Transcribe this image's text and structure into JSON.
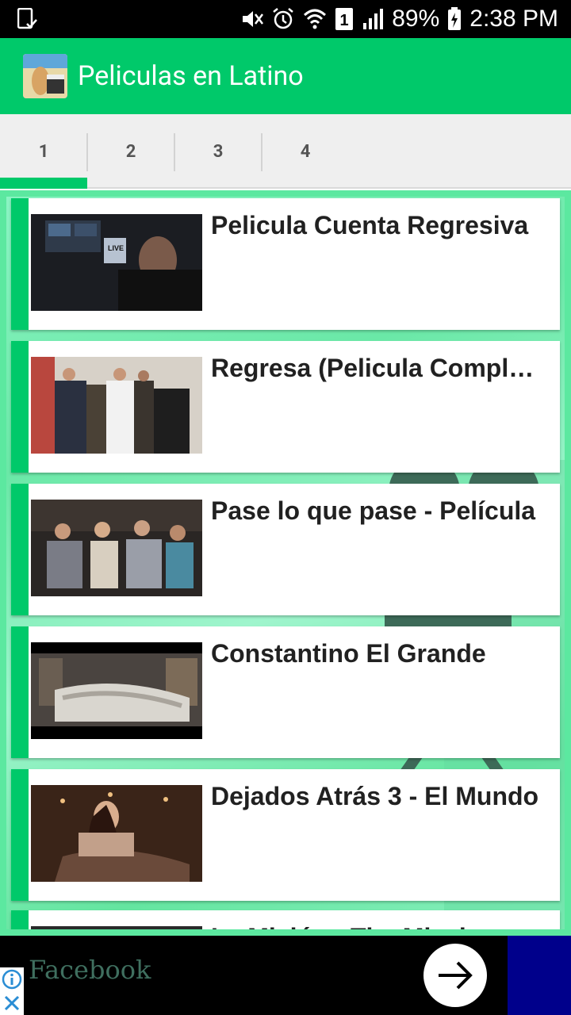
{
  "status_bar": {
    "battery": "89%",
    "time": "2:38 PM",
    "sim_badge": "1",
    "icons": [
      "download-done-icon",
      "mute-icon",
      "alarm-icon",
      "wifi-icon",
      "sim-icon",
      "signal-icon",
      "battery-charging-icon"
    ]
  },
  "app_bar": {
    "title": "Peliculas en Latino",
    "logo_text": "Peliculas en LATINO"
  },
  "tabs": [
    {
      "label": "1",
      "selected": true
    },
    {
      "label": "2",
      "selected": false
    },
    {
      "label": "3",
      "selected": false
    },
    {
      "label": "4",
      "selected": false
    }
  ],
  "videos": [
    {
      "title": "Pelicula Cuenta Regresiva"
    },
    {
      "title": "Regresa (Pelicula Completa)"
    },
    {
      "title": "Pase lo que pase - Película"
    },
    {
      "title": "Constantino El Grande"
    },
    {
      "title": "Dejados Atrás 3 - El Mundo"
    },
    {
      "title": "La Misión - The Mission"
    }
  ],
  "ad": {
    "brand": "Facebook",
    "cta_icon": "arrow-right-icon",
    "info_icon": "info-icon",
    "close_icon": "close-icon"
  },
  "colors": {
    "primary": "#00c96a",
    "status_bar": "#000000",
    "card_title": "#212121",
    "tab_text": "#555555",
    "ad_brand": "#3f6f5f",
    "ad_blue": "#00008b"
  }
}
